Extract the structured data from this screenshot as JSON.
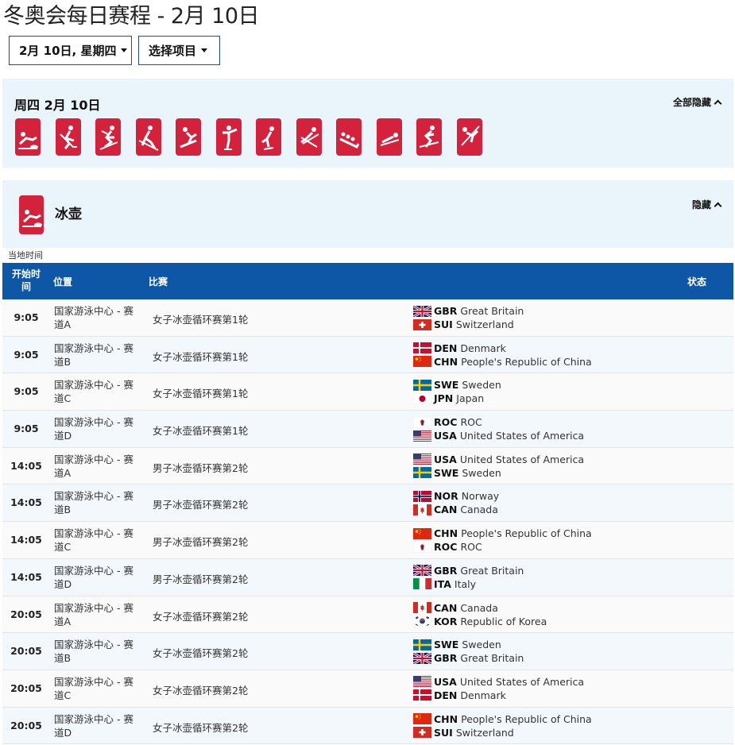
{
  "page": {
    "title": "冬奥会每日赛程 - 2月 10日"
  },
  "filters": {
    "date_label": "2月 10日, 星期四",
    "sport_label": "选择项目"
  },
  "day_panel": {
    "title": "周四 2月 10日",
    "hide_all_label": "全部隐藏",
    "sport_icons": [
      "curling-icon",
      "hockey-icon",
      "biathlon-icon",
      "cross-country-icon",
      "snowboard-icon",
      "figure-skating-icon",
      "speed-skating-icon",
      "ski-jumping-icon",
      "bobsleigh-icon",
      "luge-icon",
      "alpine-skiing-icon",
      "freestyle-skiing-icon"
    ]
  },
  "sport_panel": {
    "name": "冰壶",
    "hide_label": "隐藏",
    "icon": "curling-icon"
  },
  "local_time_label": "当地时间",
  "table": {
    "headers": {
      "time": "开始时间",
      "venue": "位置",
      "event": "比赛",
      "status": "状态"
    },
    "rows": [
      {
        "time": "9:05",
        "venue": "国家游泳中心 - 赛道A",
        "event": "女子冰壶循环赛第1轮",
        "teams": [
          {
            "flag": "gbr",
            "code": "GBR",
            "name": "Great Britain"
          },
          {
            "flag": "sui",
            "code": "SUI",
            "name": "Switzerland"
          }
        ]
      },
      {
        "time": "9:05",
        "venue": "国家游泳中心 - 赛道B",
        "event": "女子冰壶循环赛第1轮",
        "teams": [
          {
            "flag": "den",
            "code": "DEN",
            "name": "Denmark"
          },
          {
            "flag": "chn",
            "code": "CHN",
            "name": "People's Republic of China"
          }
        ]
      },
      {
        "time": "9:05",
        "venue": "国家游泳中心 - 赛道C",
        "event": "女子冰壶循环赛第1轮",
        "teams": [
          {
            "flag": "swe",
            "code": "SWE",
            "name": "Sweden"
          },
          {
            "flag": "jpn",
            "code": "JPN",
            "name": "Japan"
          }
        ]
      },
      {
        "time": "9:05",
        "venue": "国家游泳中心 - 赛道D",
        "event": "女子冰壶循环赛第1轮",
        "teams": [
          {
            "flag": "roc",
            "code": "ROC",
            "name": "ROC"
          },
          {
            "flag": "usa",
            "code": "USA",
            "name": "United States of America"
          }
        ]
      },
      {
        "time": "14:05",
        "venue": "国家游泳中心 - 赛道A",
        "event": "男子冰壶循环赛第2轮",
        "teams": [
          {
            "flag": "usa",
            "code": "USA",
            "name": "United States of America"
          },
          {
            "flag": "swe",
            "code": "SWE",
            "name": "Sweden"
          }
        ]
      },
      {
        "time": "14:05",
        "venue": "国家游泳中心 - 赛道B",
        "event": "男子冰壶循环赛第2轮",
        "teams": [
          {
            "flag": "nor",
            "code": "NOR",
            "name": "Norway"
          },
          {
            "flag": "can",
            "code": "CAN",
            "name": "Canada"
          }
        ]
      },
      {
        "time": "14:05",
        "venue": "国家游泳中心 - 赛道C",
        "event": "男子冰壶循环赛第2轮",
        "teams": [
          {
            "flag": "chn",
            "code": "CHN",
            "name": "People's Republic of China"
          },
          {
            "flag": "roc",
            "code": "ROC",
            "name": "ROC"
          }
        ]
      },
      {
        "time": "14:05",
        "venue": "国家游泳中心 - 赛道D",
        "event": "男子冰壶循环赛第2轮",
        "teams": [
          {
            "flag": "gbr",
            "code": "GBR",
            "name": "Great Britain"
          },
          {
            "flag": "ita",
            "code": "ITA",
            "name": "Italy"
          }
        ]
      },
      {
        "time": "20:05",
        "venue": "国家游泳中心 - 赛道A",
        "event": "女子冰壶循环赛第2轮",
        "teams": [
          {
            "flag": "can",
            "code": "CAN",
            "name": "Canada"
          },
          {
            "flag": "kor",
            "code": "KOR",
            "name": "Republic of Korea"
          }
        ]
      },
      {
        "time": "20:05",
        "venue": "国家游泳中心 - 赛道B",
        "event": "女子冰壶循环赛第2轮",
        "teams": [
          {
            "flag": "swe",
            "code": "SWE",
            "name": "Sweden"
          },
          {
            "flag": "gbr",
            "code": "GBR",
            "name": "Great Britain"
          }
        ]
      },
      {
        "time": "20:05",
        "venue": "国家游泳中心 - 赛道C",
        "event": "女子冰壶循环赛第2轮",
        "teams": [
          {
            "flag": "usa",
            "code": "USA",
            "name": "United States of America"
          },
          {
            "flag": "den",
            "code": "DEN",
            "name": "Denmark"
          }
        ]
      },
      {
        "time": "20:05",
        "venue": "国家游泳中心 - 赛道D",
        "event": "女子冰壶循环赛第2轮",
        "teams": [
          {
            "flag": "chn",
            "code": "CHN",
            "name": "People's Republic of China"
          },
          {
            "flag": "sui",
            "code": "SUI",
            "name": "Switzerland"
          }
        ]
      }
    ]
  },
  "colors": {
    "header_blue": "#0e56a6",
    "panel_bg": "#eaf4fb",
    "pictogram_red": "#d4213c",
    "dropdown_border": "#1f4e96"
  }
}
